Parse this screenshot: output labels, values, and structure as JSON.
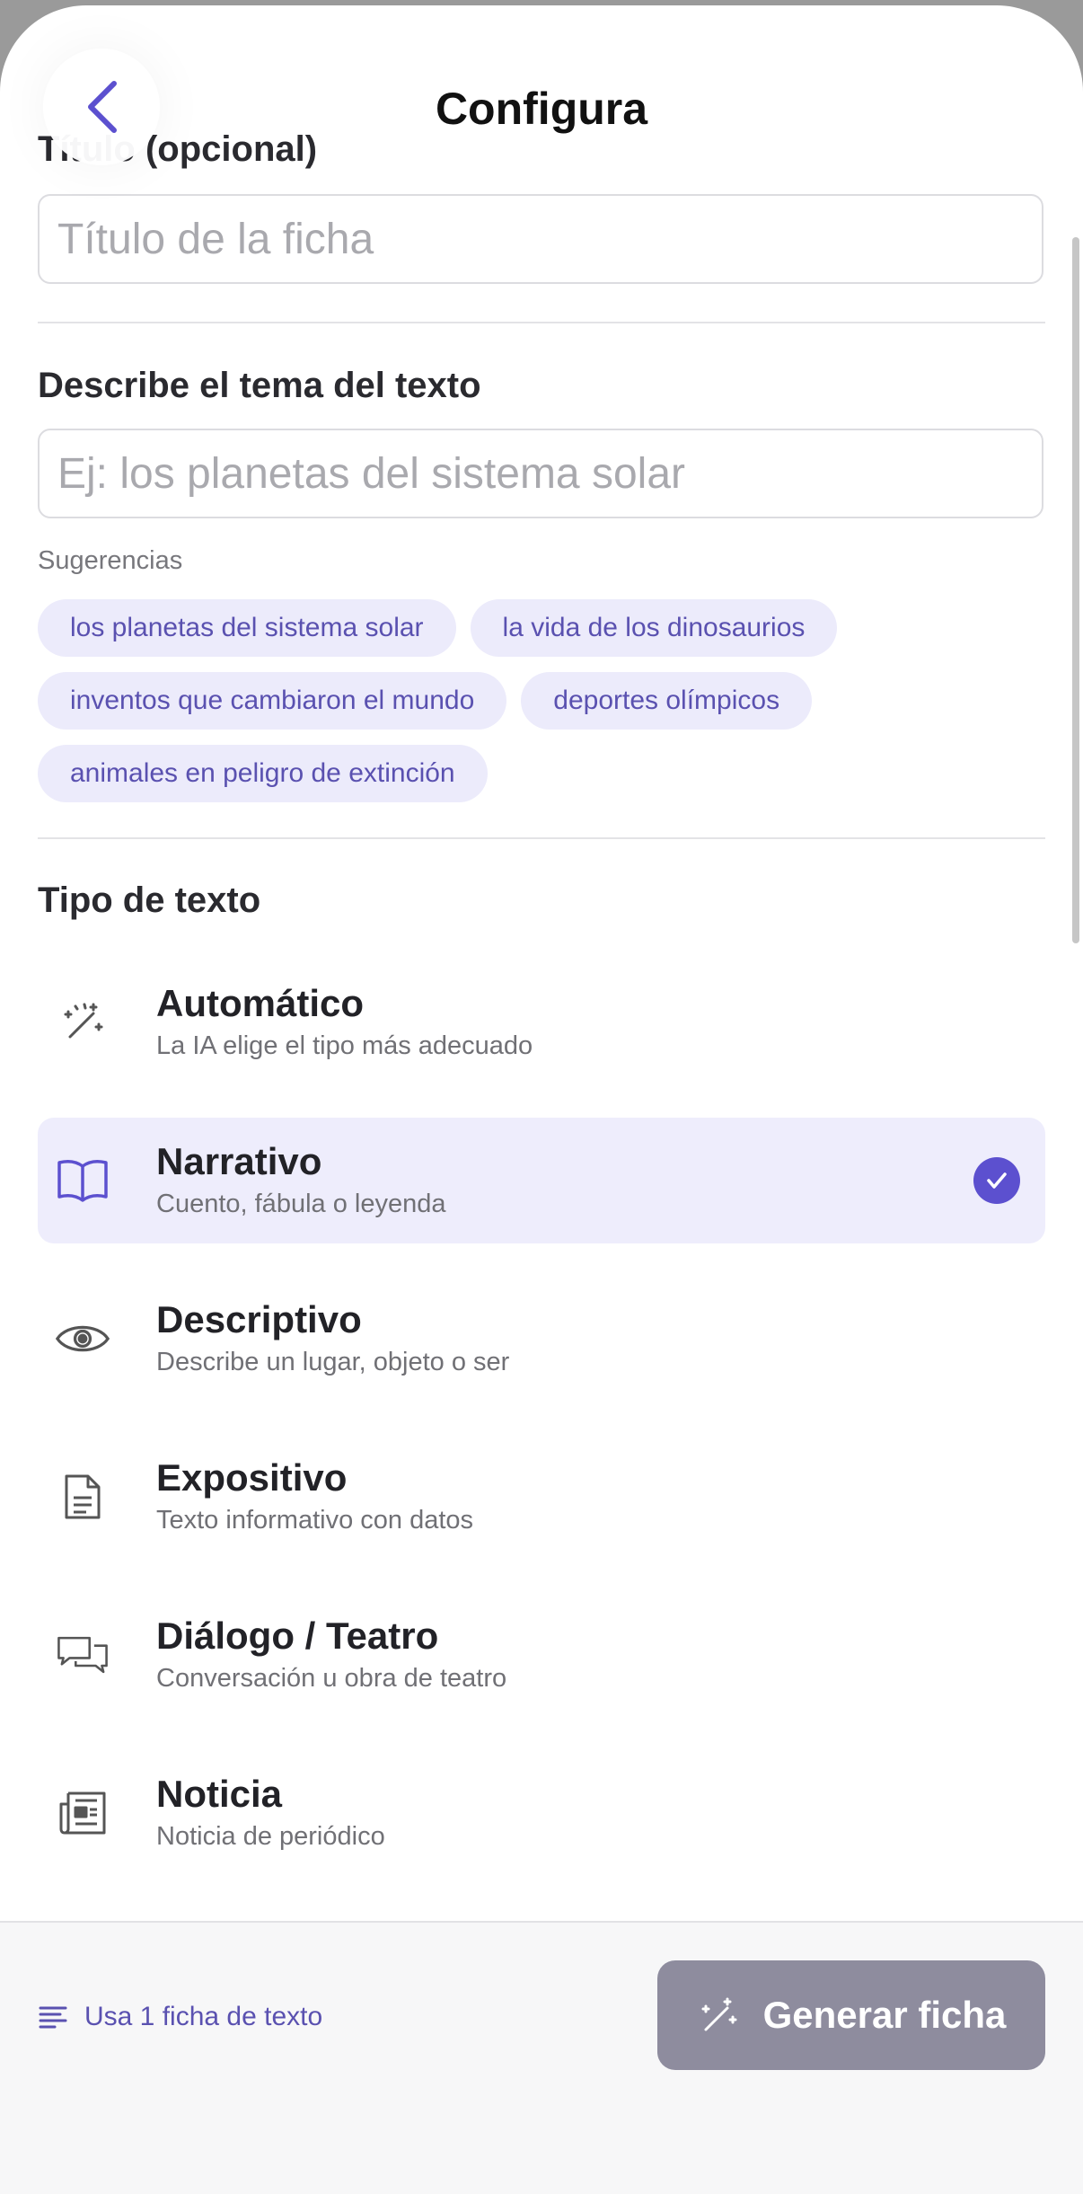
{
  "header": {
    "title": "Configura"
  },
  "title_field": {
    "label": "Título (opcional)",
    "placeholder": "Título de la ficha",
    "value": ""
  },
  "topic_field": {
    "label": "Describe el tema del texto",
    "placeholder": "Ej: los planetas del sistema solar",
    "value": ""
  },
  "suggestions": {
    "label": "Sugerencias",
    "items": [
      "los planetas del sistema solar",
      "la vida de los dinosaurios",
      "inventos que cambiaron el mundo",
      "deportes olímpicos",
      "animales en peligro de extinción"
    ]
  },
  "text_type": {
    "label": "Tipo de texto",
    "selected": "Narrativo",
    "options": [
      {
        "name": "Automático",
        "desc": "La IA elige el tipo más adecuado",
        "icon": "magic-wand-icon"
      },
      {
        "name": "Narrativo",
        "desc": "Cuento, fábula o leyenda",
        "icon": "book-icon"
      },
      {
        "name": "Descriptivo",
        "desc": "Describe un lugar, objeto o ser",
        "icon": "eye-icon"
      },
      {
        "name": "Expositivo",
        "desc": "Texto informativo con datos",
        "icon": "document-icon"
      },
      {
        "name": "Diálogo / Teatro",
        "desc": "Conversación u obra de teatro",
        "icon": "chat-bubbles-icon"
      },
      {
        "name": "Noticia",
        "desc": "Noticia de periódico",
        "icon": "newspaper-icon"
      }
    ]
  },
  "footer": {
    "usage_text": "Usa 1 ficha de texto",
    "generate_label": "Generar ficha"
  },
  "colors": {
    "accent": "#5c50cf",
    "chip_bg": "#ecebfb",
    "selected_bg": "#eeedfc",
    "button_disabled": "#8e8c9e"
  }
}
